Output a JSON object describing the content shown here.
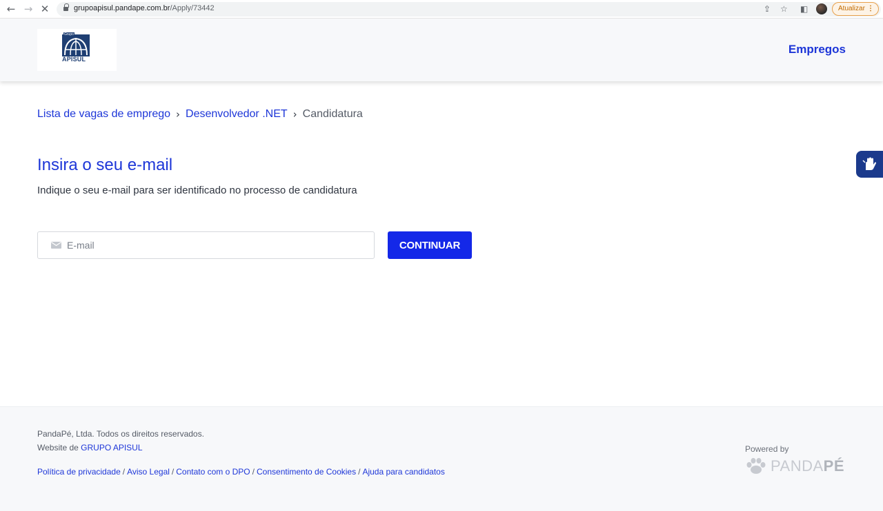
{
  "browser": {
    "url_host": "grupoapisul.pandape.com.br",
    "url_path": "/Apply/73442",
    "update_label": "Atualizar",
    "update_dots": "⋮"
  },
  "header": {
    "logo_grupo": "Grupo",
    "logo_text": "APISUL",
    "nav_link": "Empregos"
  },
  "breadcrumb": {
    "items": [
      "Lista de vagas de emprego",
      "Desenvolvedor .NET",
      "Candidatura"
    ],
    "separator": "›"
  },
  "main": {
    "title": "Insira o seu e-mail",
    "subtitle": "Indique o seu e-mail para ser identificado no processo de candidatura",
    "email_placeholder": "E-mail",
    "email_value": "",
    "continue_label": "CONTINUAR"
  },
  "footer": {
    "copyright": "PandaPé, Ltda. Todos os direitos reservados.",
    "website_prefix": "Website de ",
    "website_link": "GRUPO APISUL",
    "links": [
      "Política de privacidade",
      "Aviso Legal",
      "Contato com o DPO",
      "Consentimento de Cookies",
      "Ajuda para candidatos"
    ],
    "powered_by": "Powered by",
    "brand_light": "PANDA",
    "brand_bold": "PÉ"
  },
  "icons": {
    "back": "arrow-left-icon",
    "forward": "arrow-right-icon",
    "stop": "close-icon",
    "lock": "lock-icon",
    "share": "share-icon",
    "bookmark": "star-icon",
    "sidepanel": "side-panel-icon",
    "mail": "envelope-icon",
    "accessibility": "sign-language-icon",
    "panda": "paw-icon"
  },
  "colors": {
    "primary": "#1d36d8",
    "button": "#1428e8",
    "accessibility_tab": "#1b3a8c",
    "footer_bg": "#f7f8fa"
  }
}
